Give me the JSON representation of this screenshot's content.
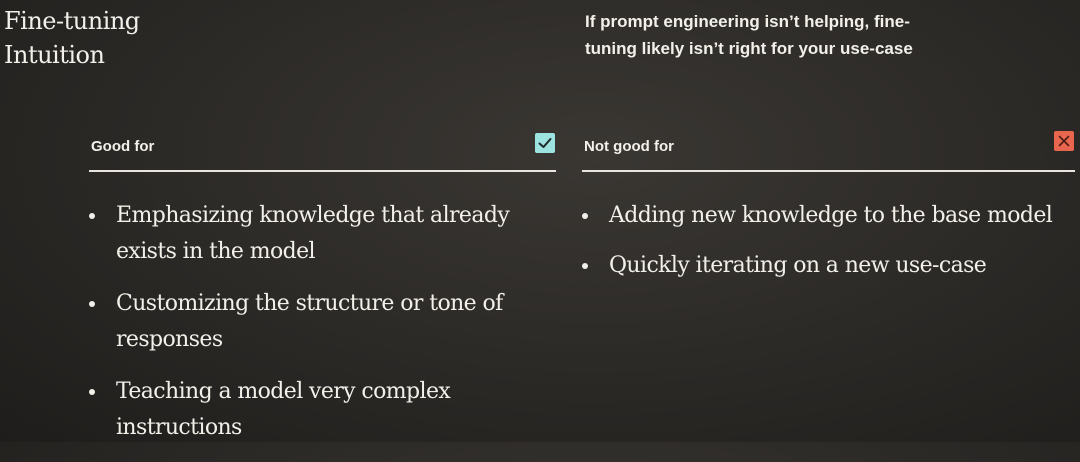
{
  "title_lines": [
    "Fine-tuning",
    "Intuition"
  ],
  "subtitle_lines": [
    "If prompt engineering isn’t helping, fine-",
    "tuning likely isn’t right for your use-case"
  ],
  "good_for": {
    "label": "Good for",
    "badge_icon": "check-icon",
    "badge_color": "#9de3df",
    "items": [
      [
        "Emphasizing knowledge that already",
        "exists in the model"
      ],
      [
        "Customizing the structure or tone of",
        "responses"
      ],
      [
        "Teaching a model very complex",
        "instructions"
      ]
    ]
  },
  "not_good_for": {
    "label": "Not good for",
    "badge_icon": "x-icon",
    "badge_color": "#e8664d",
    "items": [
      [
        "Adding new knowledge to the base model"
      ],
      [
        "Quickly iterating on a new use-case"
      ]
    ]
  }
}
